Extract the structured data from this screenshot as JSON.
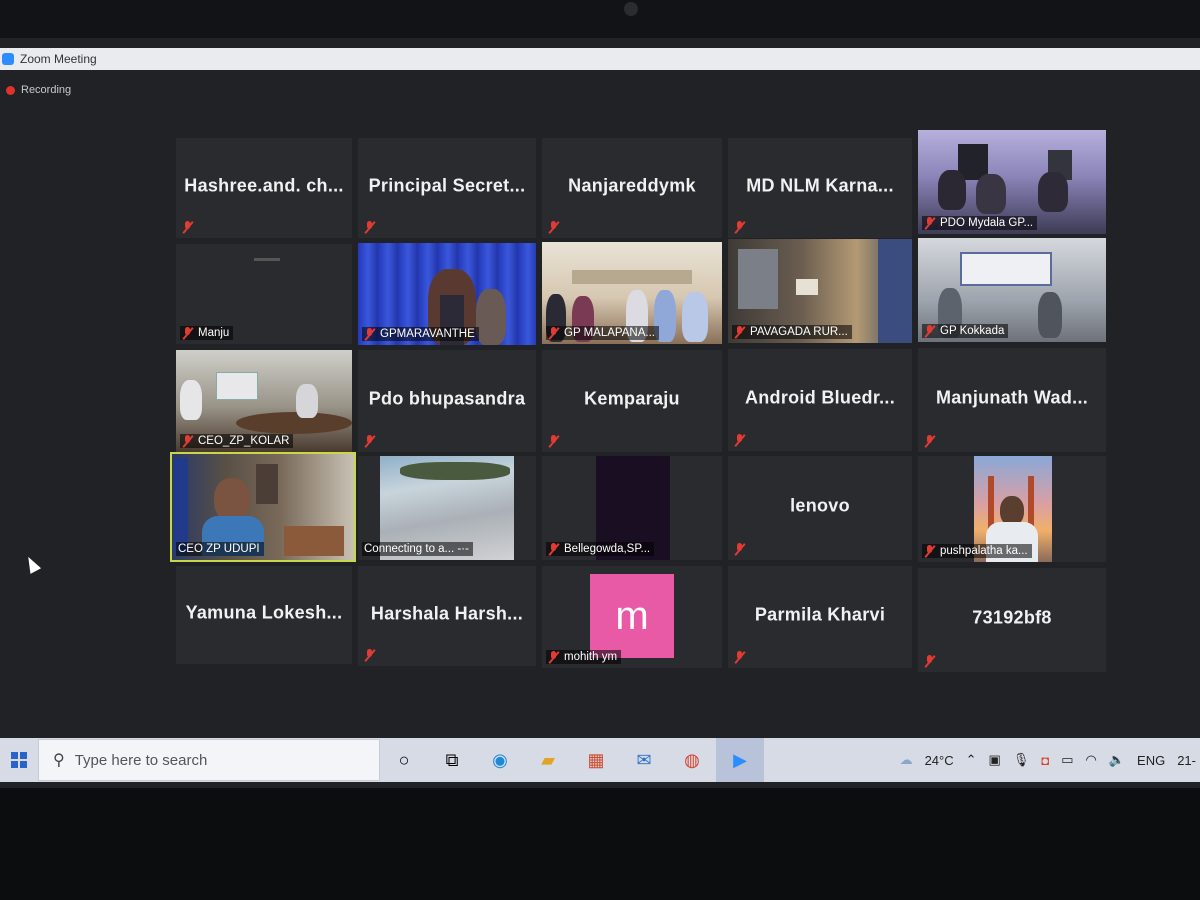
{
  "window": {
    "title": "Zoom Meeting",
    "recording_label": "Recording"
  },
  "row1": [
    {
      "name": "Hashree.and. ch..."
    },
    {
      "name": "Principal Secret..."
    },
    {
      "name": "Nanjareddymk"
    },
    {
      "name": "MD NLM Karna..."
    },
    {
      "label": "PDO Mydala GP..."
    }
  ],
  "row2": [
    {
      "label": "Manju"
    },
    {
      "label": "GPMARAVANTHE"
    },
    {
      "label": "GP MALAPANA..."
    },
    {
      "label": "PAVAGADA RUR..."
    },
    {
      "label": "GP Kokkada"
    }
  ],
  "row3": [
    {
      "label": "CEO_ZP_KOLAR"
    },
    {
      "name": "Pdo bhupasandra"
    },
    {
      "name": "Kemparaju"
    },
    {
      "name": "Android Bluedr..."
    },
    {
      "name": "Manjunath Wad..."
    }
  ],
  "row4": [
    {
      "label": "CEO ZP UDUPI"
    },
    {
      "label": "Connecting to a... -·-"
    },
    {
      "label": "Bellegowda,SP..."
    },
    {
      "name": "lenovo"
    },
    {
      "label": "pushpalatha ka..."
    }
  ],
  "row5": [
    {
      "name": "Yamuna Lokesh..."
    },
    {
      "name": "Harshala Harsh..."
    },
    {
      "label": "mohith ym",
      "avatar_letter": "m"
    },
    {
      "name": "Parmila Kharvi"
    },
    {
      "name": "73192bf8"
    }
  ],
  "taskbar": {
    "search_placeholder": "Type here to search",
    "temperature": "24°C",
    "language": "ENG",
    "date_fragment": "21-"
  },
  "colors": {
    "active_speaker": "#c8d84a",
    "mute_red": "#e23b33",
    "avatar_pink": "#e85aa6",
    "zoom_blue": "#2d8cff"
  }
}
